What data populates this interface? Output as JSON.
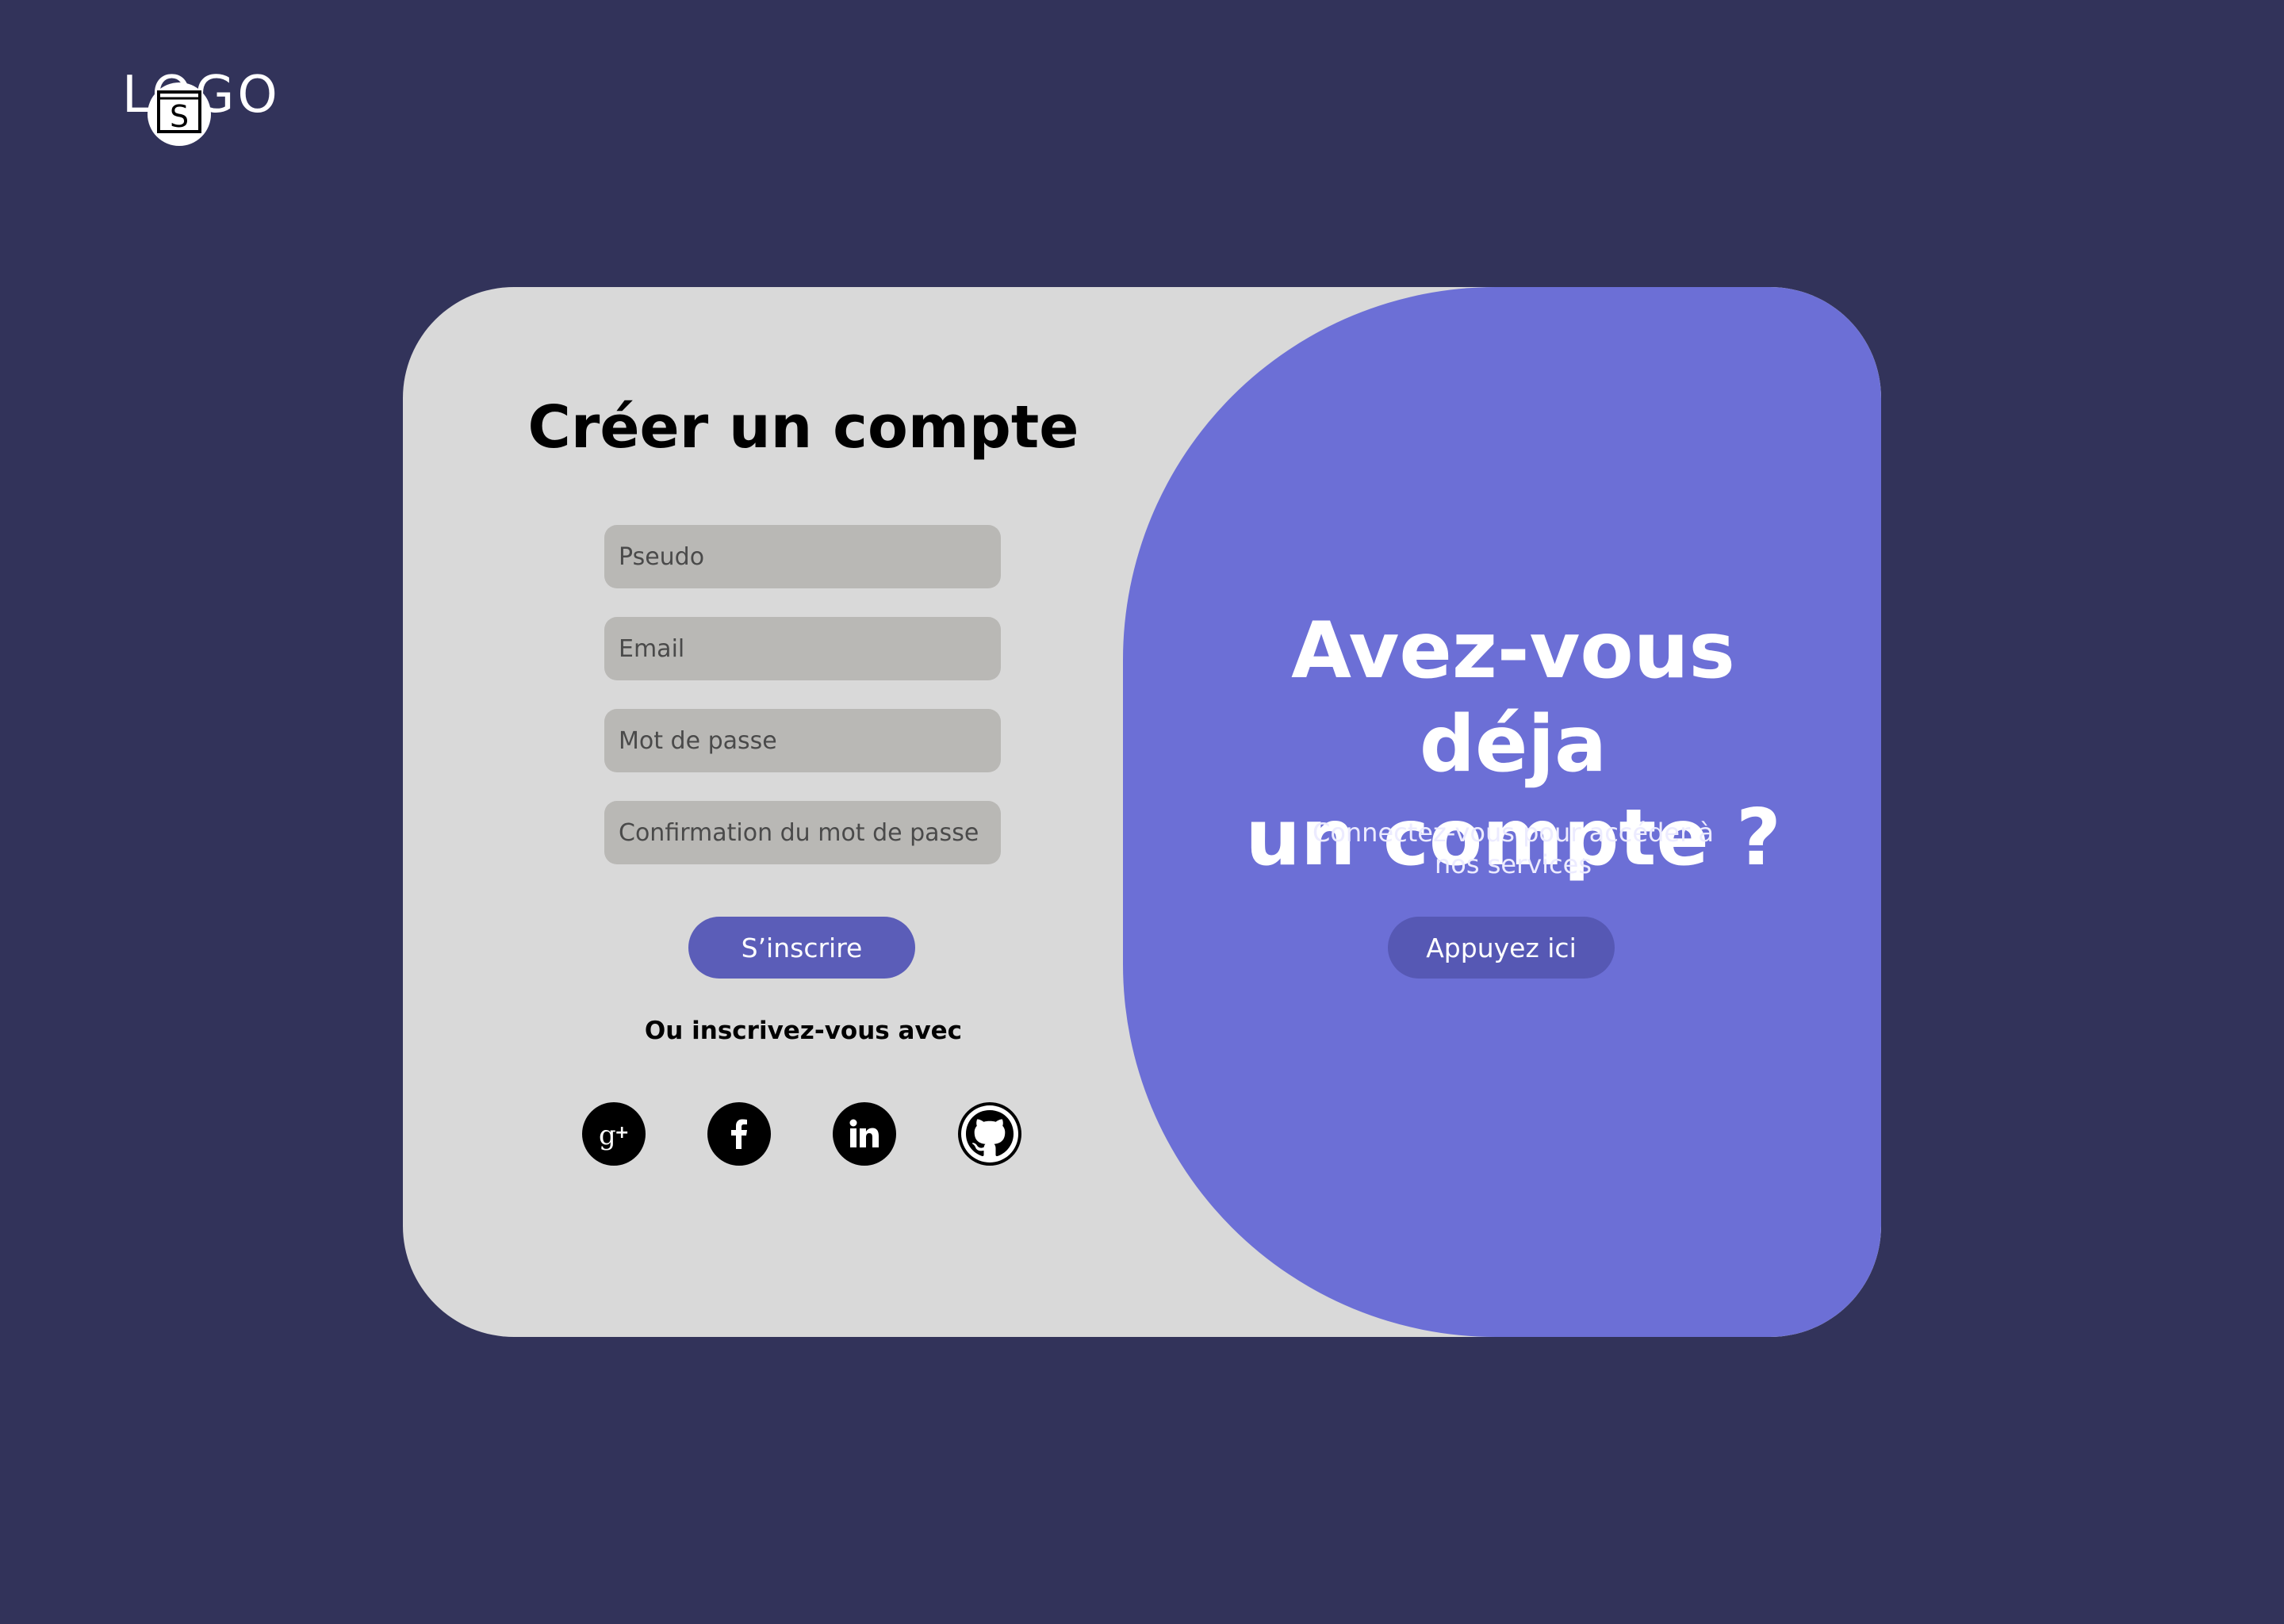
{
  "logo": {
    "text": "LOGO",
    "badge_letter": "S"
  },
  "signup": {
    "title": "Créer un compte",
    "fields": [
      {
        "placeholder": "Pseudo"
      },
      {
        "placeholder": "Email"
      },
      {
        "placeholder": "Mot de passe"
      },
      {
        "placeholder": "Confirmation du mot de passe"
      }
    ],
    "submit_label": "S’inscrire",
    "alt_label": "Ou inscrivez-vous avec",
    "social": [
      {
        "icon": "google-plus-icon"
      },
      {
        "icon": "facebook-icon"
      },
      {
        "icon": "linkedin-icon"
      },
      {
        "icon": "github-icon"
      }
    ]
  },
  "login_cta": {
    "title_line1": "Avez-vous déja",
    "title_line2": "un compte ?",
    "subtitle_line1": "Connectez-vous pour accéder à",
    "subtitle_line2": "nos services",
    "button_label": "Appuyez ici"
  },
  "colors": {
    "background": "#32335a",
    "card": "#d9d9d9",
    "accent_panel": "#6c6fd6",
    "button": "#5b5db8",
    "field": "#b9b8b5"
  }
}
